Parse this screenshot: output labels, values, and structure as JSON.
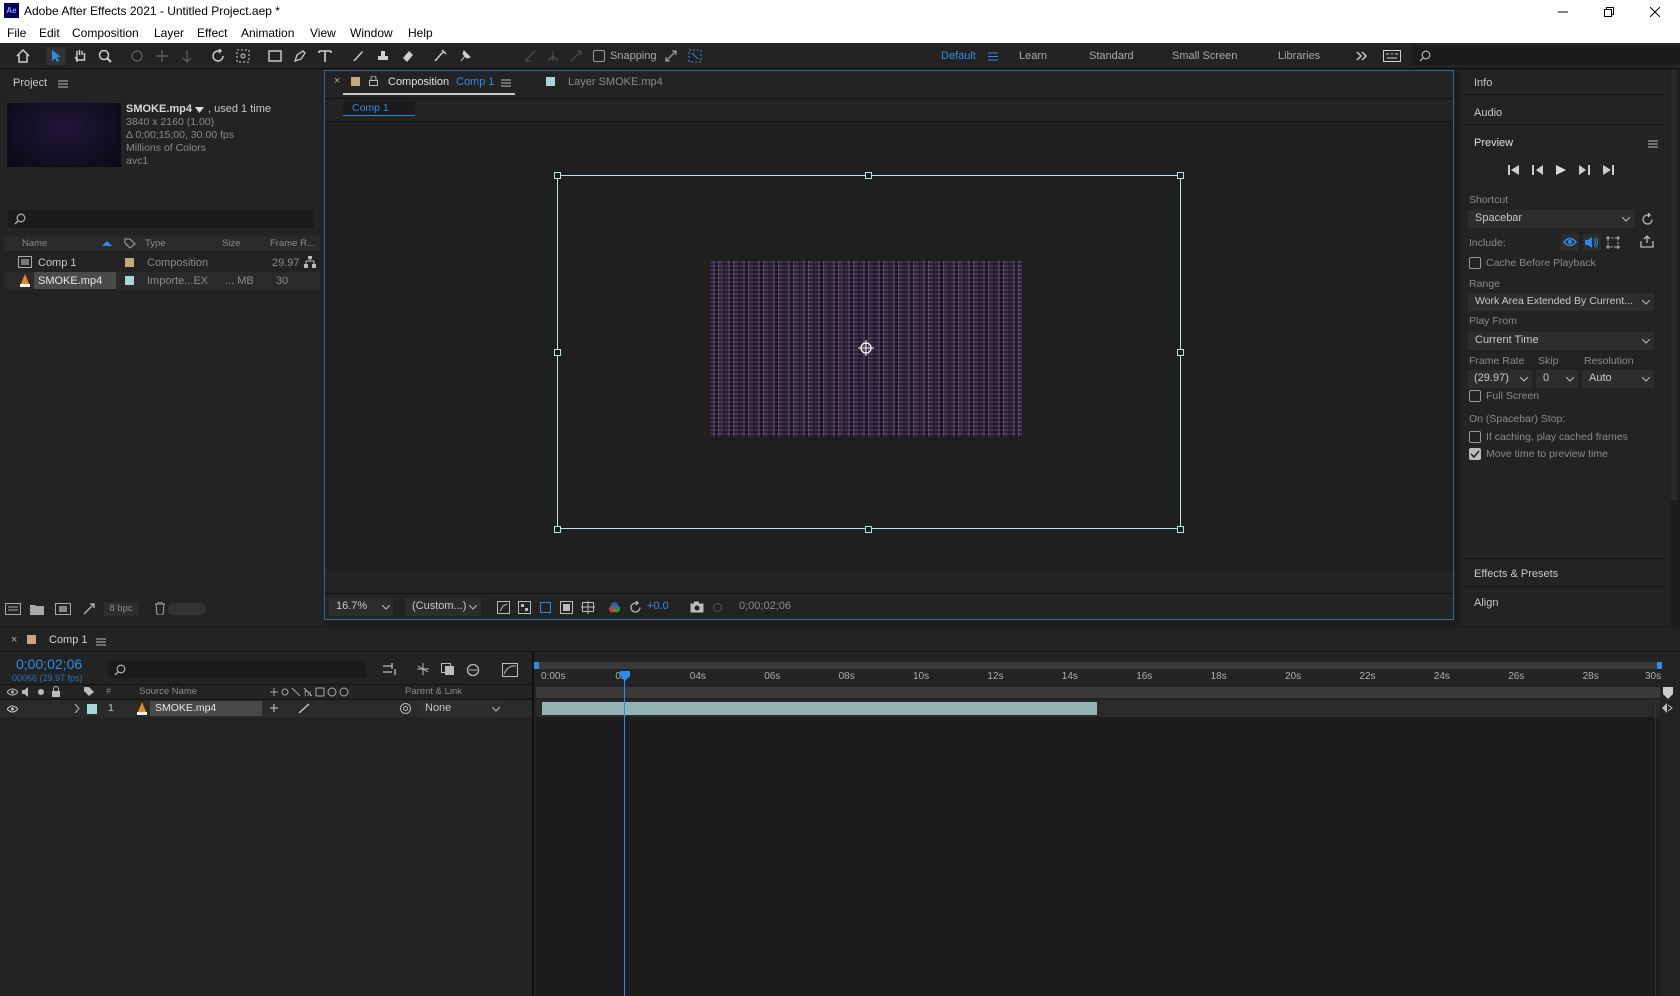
{
  "app": {
    "title": "Adobe After Effects 2021 - Untitled Project.aep *",
    "icon_text": "Ae"
  },
  "menu": [
    "File",
    "Edit",
    "Composition",
    "Layer",
    "Effect",
    "Animation",
    "View",
    "Window",
    "Help"
  ],
  "toolbar": {
    "snapping_label": "Snapping",
    "workspaces": [
      "Default",
      "Learn",
      "Standard",
      "Small Screen",
      "Libraries"
    ],
    "active_workspace": "Default"
  },
  "project": {
    "panel_title": "Project",
    "asset_name": "SMOKE.mp4",
    "asset_used": ", used 1 time",
    "asset_info": [
      "3840 x 2160 (1.00)",
      "Δ 0;00;15;00, 30.00 fps",
      "Millions of Colors",
      "avc1"
    ],
    "columns": [
      "Name",
      "Type",
      "Size",
      "Frame R..."
    ],
    "items": [
      {
        "name": "Comp 1",
        "type": "Composition",
        "size": "",
        "frame_rate": "29.97",
        "swatch": "#c7a77f"
      },
      {
        "name": "SMOKE.mp4",
        "type": "Importe...EX",
        "size": "... MB",
        "frame_rate": "30",
        "swatch": "#a7d6d6"
      }
    ],
    "bpc": "8 bpc"
  },
  "viewer": {
    "tab_comp_prefix": "Composition",
    "tab_comp_name": "Comp 1",
    "tab_layer": "Layer SMOKE.mp4",
    "crumb": "Comp 1",
    "zoom": "16.7%",
    "resolution": "(Custom...)",
    "exposure": "+0.0",
    "timecode": "0;00;02;06"
  },
  "right": {
    "info": "Info",
    "audio": "Audio",
    "preview": "Preview",
    "shortcut_label": "Shortcut",
    "shortcut_value": "Spacebar",
    "include_label": "Include:",
    "cache_label": "Cache Before Playback",
    "range_label": "Range",
    "range_value": "Work Area Extended By Current...",
    "play_from_label": "Play From",
    "play_from_value": "Current Time",
    "frame_rate_label": "Frame Rate",
    "skip_label": "Skip",
    "resolution_label": "Resolution",
    "frame_rate_value": "(29.97)",
    "skip_value": "0",
    "resolution_value": "Auto",
    "full_screen_label": "Full Screen",
    "stop_label": "On (Spacebar) Stop:",
    "if_caching_label": "If caching, play cached frames",
    "move_time_label": "Move time to preview time",
    "effects": "Effects & Presets",
    "align": "Align"
  },
  "timeline": {
    "tab": "Comp 1",
    "timecode": "0;00;02;06",
    "frame_info": "00066 (29.97 fps)",
    "col_source": "Source Name",
    "col_parent": "Parent & Link",
    "col_num": "#",
    "layer_num": "1",
    "layer_name": "SMOKE.mp4",
    "parent_value": "None",
    "ticks": [
      "0:00s",
      "02",
      "04s",
      "06s",
      "08s",
      "10s",
      "12s",
      "14s",
      "16s",
      "18s",
      "20s",
      "22s",
      "24s",
      "26s",
      "28s",
      "30s"
    ],
    "ruler_max_s": 30,
    "playhead_s": 2.2,
    "layer_end_s": 15,
    "layer_color": "#a6cccb"
  },
  "colors": {
    "accent": "#2d8ceb",
    "bg": "#1d1d1d",
    "panel": "#232323"
  }
}
